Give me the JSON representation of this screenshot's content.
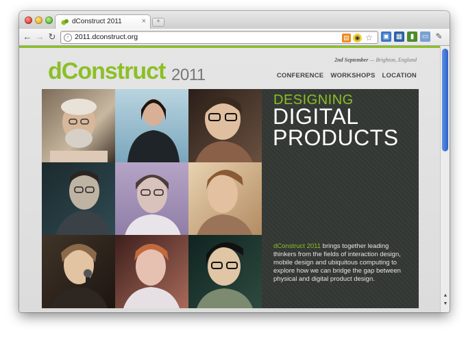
{
  "browser": {
    "tab_title": "dConstruct 2011",
    "tab_close": "×",
    "new_tab": "+",
    "url": "2011.dconstruct.org",
    "nav": {
      "back": "←",
      "forward": "→",
      "reload": "↻"
    },
    "icons": [
      "back-icon",
      "forward-icon",
      "reload-icon",
      "site-info-icon",
      "rss-icon",
      "extension-icon",
      "bookmark-star-icon",
      "screen-icon",
      "window-icon",
      "clipboard-icon",
      "page-icon",
      "wrench-icon"
    ]
  },
  "site": {
    "logo": "dConstruct",
    "logo_year": "2011",
    "date": "2nd September",
    "location": "— Brighton, England",
    "nav": [
      "CONFERENCE",
      "WORKSHOPS",
      "LOCATION"
    ],
    "hero": {
      "heading_small": "DESIGNING",
      "heading_line1": "DIGITAL",
      "heading_line2": "PRODUCTS",
      "blurb_accent": "dConstruct 2011",
      "blurb_rest": " brings together leading thinkers from the fields of interaction design, mobile design and ubiquitous computing to explore how we can bridge the gap between physical and digital product design."
    },
    "colors": {
      "accent": "#8cbf26",
      "panel": "#333733",
      "window_bg": "#dcdcdc"
    }
  }
}
